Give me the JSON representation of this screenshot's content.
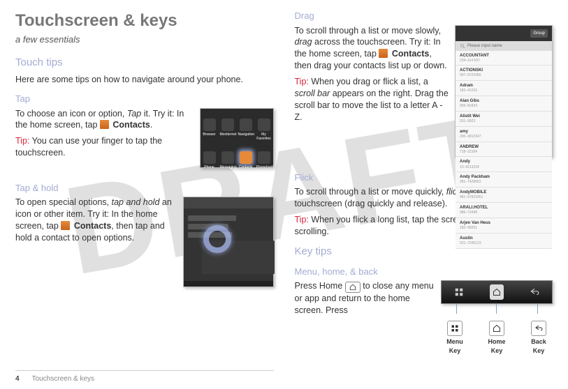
{
  "watermark": "DRAFT",
  "header": {
    "title": "Touchscreen & keys",
    "subtitle": "a few essentials"
  },
  "left": {
    "touchTipsHeading": "Touch tips",
    "touchTipsIntro": "Here are some tips on how to navigate around your phone.",
    "tapHeading": "Tap",
    "tap_p1a": "To choose an icon or option, ",
    "tap_p1b": "Tap",
    "tap_p1c": " it. Try it: In the home screen, tap ",
    "tap_contacts": "Contacts",
    "tap_p1d": ".",
    "tap_tipLabel": "Tip: ",
    "tap_tip": "You can use your finger to tap the touchscreen.",
    "tapHoldHeading": "Tap & hold",
    "hold_p1a": "To open special options, ",
    "hold_p1b": "tap and hold",
    "hold_p1c": " an icon or other item. Try it: In the home screen, tap ",
    "hold_contacts": "Contacts",
    "hold_p1d": ", then tap and hold a contact to open options."
  },
  "fig_home": {
    "r1": [
      "Browser",
      "Montternet",
      "Navigation",
      "My Favorites"
    ],
    "r2": [
      "Phone",
      "Messaging",
      "Contacts",
      "PhonebooK"
    ]
  },
  "right": {
    "dragHeading": "Drag",
    "drag_p1a": "To scroll through a list or move slowly, ",
    "drag_p1b": "drag",
    "drag_p1c": " across the touchscreen. Try it: In the home screen, tap ",
    "drag_contacts": "Contacts",
    "drag_p1d": ", then drag your contacts list up or down.",
    "drag_tipLabel": "Tip: ",
    "drag_tip_a": "When you drag or flick a list, a ",
    "drag_tip_b": "scroll bar",
    "drag_tip_c": " appears on the right. Drag the scroll bar to move the list to a letter A - Z.",
    "flickHeading": "Flick",
    "flick_p1a": "To scroll through a list or move quickly, ",
    "flick_p1b": "flick",
    "flick_p1c": " across the touchscreen (drag quickly and release).",
    "flick_tipLabel": "Tip: ",
    "flick_tip": "When you flick a long list, tap the screen to stop it from scrolling.",
    "keyTipsHeading": "Key tips",
    "menuHeading": "Menu, home, & back",
    "key_p1a": "Press Home ",
    "key_p1b": " to close any menu or app and return to the home screen. Press"
  },
  "fig_drag": {
    "groupBtn": "Group",
    "placeholder": "Please input name",
    "items": [
      {
        "n": "ACCOUNTANT",
        "s": "234–114 597"
      },
      {
        "n": "ACTIONSKI",
        "s": "097–9723456"
      },
      {
        "n": "Adram",
        "s": "183–41232"
      },
      {
        "n": "Alan Gibs",
        "s": "093–81834"
      },
      {
        "n": "Alistit Wei",
        "s": "201–9923"
      },
      {
        "n": "amy",
        "s": "200–3812347"
      },
      {
        "n": "ANDREW",
        "s": "718–32394"
      },
      {
        "n": "Andy",
        "s": "15–9213234"
      },
      {
        "n": "Andy Packham",
        "s": "281–7428901"
      },
      {
        "n": "AndyMOBILE",
        "s": "481–97823451"
      },
      {
        "n": "ARALI.HOTEL",
        "s": "086–73498"
      },
      {
        "n": "Arjen Van Heus",
        "s": "182–99201"
      },
      {
        "n": "Austin",
        "s": "031–7240123"
      }
    ]
  },
  "keys": {
    "menu": "Menu Key",
    "home": "Home Key",
    "back": "Back Key"
  },
  "footer": {
    "page": "4",
    "section": "Touchscreen & keys"
  }
}
